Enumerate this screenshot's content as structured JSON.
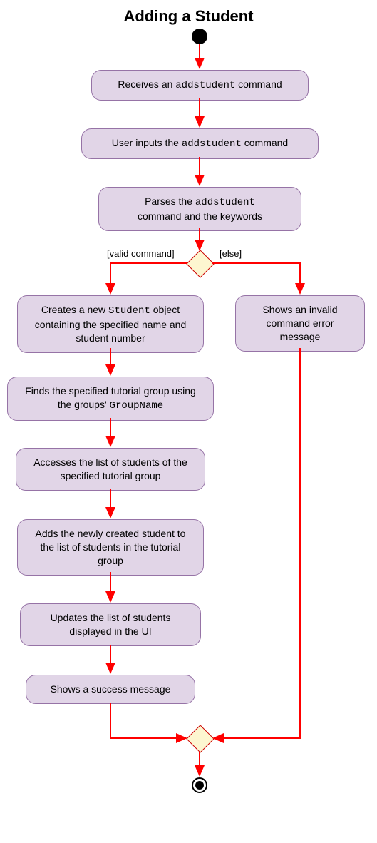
{
  "chart_data": {
    "type": "activity-diagram",
    "title": "Adding a Student",
    "start": true,
    "end": true,
    "nodes": {
      "n1": {
        "text_parts": [
          "Receives an ",
          "addstudent",
          " command"
        ],
        "code_idx": 1
      },
      "n2": {
        "text_parts": [
          "User inputs the ",
          "addstudent",
          " command"
        ],
        "code_idx": 1
      },
      "n3": {
        "text_parts": [
          "Parses the ",
          "addstudent",
          " command and the keywords"
        ],
        "code_idx": 1
      },
      "d1": {
        "type": "decision",
        "guard_left": "[valid command]",
        "guard_right": "[else]"
      },
      "n4": {
        "text_parts": [
          "Creates a new ",
          "Student",
          " object containing the specified name and student number"
        ],
        "code_idx": 1
      },
      "n5": {
        "text_parts": [
          "Finds the specified tutorial group using the groups' ",
          "GroupName"
        ],
        "code_idx": 1
      },
      "n6": {
        "text": "Accesses the list of students of the specified tutorial group"
      },
      "n7": {
        "text": "Adds the newly created student to the list of students in the tutorial group"
      },
      "n8": {
        "text": "Updates the list of students displayed in the UI"
      },
      "n9": {
        "text": "Shows a success message"
      },
      "n10": {
        "text": "Shows an invalid command error message"
      },
      "m1": {
        "type": "merge"
      }
    },
    "edges": [
      [
        "start",
        "n1"
      ],
      [
        "n1",
        "n2"
      ],
      [
        "n2",
        "n3"
      ],
      [
        "n3",
        "d1"
      ],
      [
        "d1",
        "n4",
        "valid command"
      ],
      [
        "d1",
        "n10",
        "else"
      ],
      [
        "n4",
        "n5"
      ],
      [
        "n5",
        "n6"
      ],
      [
        "n6",
        "n7"
      ],
      [
        "n7",
        "n8"
      ],
      [
        "n8",
        "n9"
      ],
      [
        "n9",
        "m1"
      ],
      [
        "n10",
        "m1"
      ],
      [
        "m1",
        "end"
      ]
    ]
  }
}
